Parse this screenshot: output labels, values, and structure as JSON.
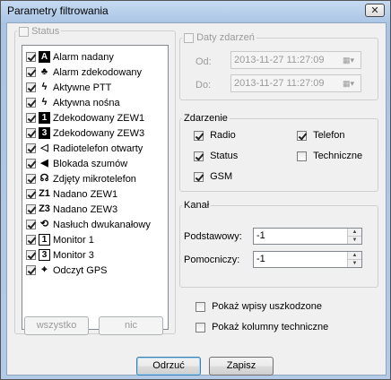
{
  "window": {
    "title": "Parametry filtrowania",
    "close_label": "✕"
  },
  "status": {
    "legend": "Status",
    "items": [
      {
        "label": "Alarm nadany",
        "icon": "alarm-sent-icon",
        "glyph": "A",
        "style": "fill"
      },
      {
        "label": "Alarm zdekodowany",
        "icon": "alarm-decoded-icon",
        "glyph": "♣",
        "style": "plain"
      },
      {
        "label": "Aktywne PTT",
        "icon": "ptt-icon",
        "glyph": "ϟ",
        "style": "plain"
      },
      {
        "label": "Aktywna nośna",
        "icon": "carrier-icon",
        "glyph": "ϟ",
        "style": "plain"
      },
      {
        "label": "Zdekodowany ZEW1",
        "icon": "decoded-call1-icon",
        "glyph": "1",
        "style": "fill"
      },
      {
        "label": "Zdekodowany ZEW3",
        "icon": "decoded-call3-icon",
        "glyph": "3",
        "style": "fill"
      },
      {
        "label": "Radiotelefon otwarty",
        "icon": "speaker-open-icon",
        "glyph": "◁",
        "style": "plain"
      },
      {
        "label": "Blokada szumów",
        "icon": "speaker-mute-icon",
        "glyph": "◀",
        "style": "plain"
      },
      {
        "label": "Zdjęty mikrotelefon",
        "icon": "microphone-icon",
        "glyph": "☊",
        "style": "plain"
      },
      {
        "label": "Nadano ZEW1",
        "icon": "sent-call1-icon",
        "glyph": "Z1",
        "style": "plain"
      },
      {
        "label": "Nadano ZEW3",
        "icon": "sent-call3-icon",
        "glyph": "Z3",
        "style": "plain"
      },
      {
        "label": "Nasłuch dwukanałowy",
        "icon": "dual-listen-icon",
        "glyph": "⟲",
        "style": "plain"
      },
      {
        "label": "Monitor 1",
        "icon": "monitor1-icon",
        "glyph": "1",
        "style": "box"
      },
      {
        "label": "Monitor 3",
        "icon": "monitor3-icon",
        "glyph": "3",
        "style": "box"
      },
      {
        "label": "Odczyt GPS",
        "icon": "gps-icon",
        "glyph": "⌖",
        "style": "plain"
      }
    ],
    "all_button": "wszystko",
    "none_button": "nic"
  },
  "dates": {
    "legend": "Daty zdarzeń",
    "from_label": "Od:",
    "from_value": "2013-11-27 11:27:09",
    "to_label": "Do:",
    "to_value": "2013-11-27 11:27:09"
  },
  "event": {
    "legend": "Zdarzenie",
    "radio": "Radio",
    "telefon": "Telefon",
    "status": "Status",
    "techniczne": "Techniczne",
    "gsm": "GSM"
  },
  "channel": {
    "legend": "Kanał",
    "primary_label": "Podstawowy:",
    "primary_value": "-1",
    "secondary_label": "Pomocniczy:",
    "secondary_value": "-1"
  },
  "options": {
    "show_deleted": "Pokaż wpisy uszkodzone",
    "show_technical_columns": "Pokaż kolumny techniczne"
  },
  "buttons": {
    "cancel": "Odrzuć",
    "save": "Zapisz"
  }
}
